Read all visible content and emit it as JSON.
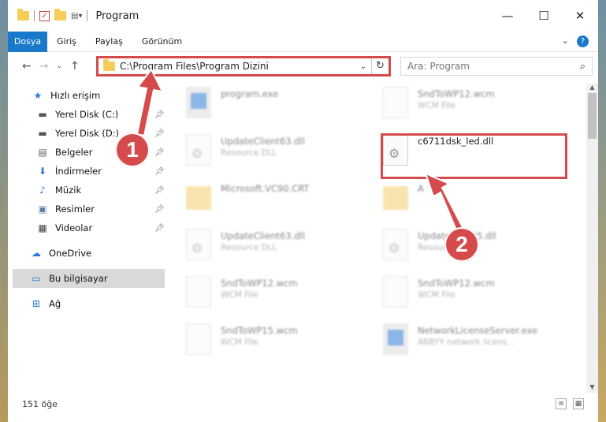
{
  "window": {
    "title": "Program",
    "minimize": "—",
    "maximize": "☐",
    "close": "✕"
  },
  "ribbon": {
    "tabs": [
      "Dosya",
      "Giriş",
      "Paylaş",
      "Görünüm"
    ],
    "expand": "⌄",
    "help": "?"
  },
  "address": {
    "path": "C:\\Program Files\\Program Dizini",
    "search_placeholder": "Ara: Program"
  },
  "sidebar": {
    "items": [
      {
        "label": "Hızlı erişim",
        "icon": "star-icon"
      },
      {
        "label": "Yerel Disk (C:)",
        "icon": "drive-icon"
      },
      {
        "label": "Yerel Disk (D:)",
        "icon": "drive-icon"
      },
      {
        "label": "Belgeler",
        "icon": "documents-icon"
      },
      {
        "label": "İndirmeler",
        "icon": "download-icon"
      },
      {
        "label": "Müzik",
        "icon": "music-icon"
      },
      {
        "label": "Resimler",
        "icon": "pictures-icon"
      },
      {
        "label": "Videolar",
        "icon": "videos-icon"
      },
      {
        "label": "OneDrive",
        "icon": "cloud-icon"
      },
      {
        "label": "Bu bilgisayar",
        "icon": "computer-icon"
      },
      {
        "label": "Ağ",
        "icon": "network-icon"
      }
    ]
  },
  "files": [
    {
      "name": "program.exe",
      "type": ""
    },
    {
      "name": "SndToWP12.wcm",
      "type": "WCM File"
    },
    {
      "name": "UpdateClient63.dll",
      "type": "Resource DLL"
    },
    {
      "name": "c6711dsk_led.dll",
      "type": ""
    },
    {
      "name": "Microsoft.VC90.CRT",
      "type": ""
    },
    {
      "name": "A",
      "type": ""
    },
    {
      "name": "UpdateClient63.dll",
      "type": "Resource DLL"
    },
    {
      "name": "UpdateClient5.dll",
      "type": "Resource DLL"
    },
    {
      "name": "SndToWP12.wcm",
      "type": "WCM File"
    },
    {
      "name": "SndToWP12.wcm",
      "type": "WCM File"
    },
    {
      "name": "SndToWP15.wcm",
      "type": "WCM File"
    },
    {
      "name": "NetworkLicenseServer.exe",
      "type": "ABBYY network licens..."
    }
  ],
  "status": {
    "count": "151 öğe"
  },
  "callouts": {
    "one": "1",
    "two": "2"
  },
  "colors": {
    "accent": "#1979ca",
    "highlight": "#d54a4a"
  }
}
